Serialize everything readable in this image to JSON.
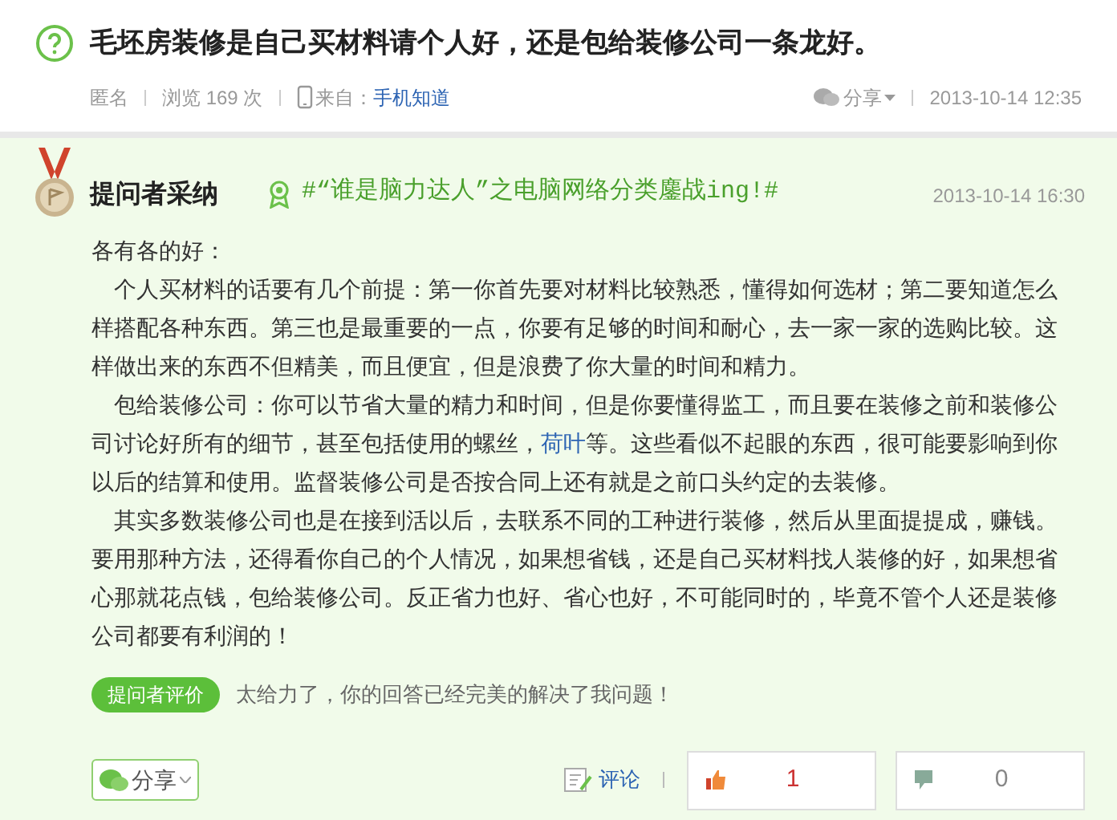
{
  "question": {
    "title": "毛坯房装修是自己买材料请个人好，还是包给装修公司一条龙好。",
    "author": "匿名",
    "views": "浏览 169 次",
    "source_label": "来自：",
    "source": "手机知道",
    "share": "分享",
    "time": "2013-10-14 12:35"
  },
  "answer": {
    "badge": "提问者采纳",
    "topic": "#“谁是脑力达人”之电脑网络分类鏖战ing!#",
    "time": "2013-10-14 16:30",
    "paragraphs": [
      [
        {
          "text": "各有各的好："
        }
      ],
      [
        {
          "text": "个人买材料的话要有几个前提：第一你首先要对材料比较熟悉，懂得如何选材；第二要知道怎么样搭配各种东西。第三也是最重要的一点，你要有足够的时间和耐心，去一家一家的选购比较。这样做出来的东西不但精美，而且便宜，但是浪费了你大量的时间和精力。"
        }
      ],
      [
        {
          "text": "包给装修公司：你可以节省大量的精力和时间，但是你要懂得监工，而且要在装修之前和装修公司讨论好所有的细节，甚至包括使用的螺丝，"
        },
        {
          "text": "荷叶",
          "kind": "link"
        },
        {
          "text": "等。这些看似不起眼的东西，很可能要影响到你以后的结算和使用。监督装修公司是否按合同上还有就是之前口头约定的去装修。"
        }
      ],
      [
        {
          "text": "其实多数装修公司也是在接到活以后，去联系不同的工种进行装修，然后从里面提提成，赚钱。要用那种方法，还得看你自己的个人情况，如果想省钱，还是自己买材料找人装修的好，如果想省心那就花点钱，包给装修公司。反正省力也好、省心也好，不可能同时的，毕竟不管个人还是装修公司都要有利润的！"
        }
      ]
    ],
    "review_label": "提问者评价",
    "review": "太给力了，你的回答已经完美的解决了我问题！",
    "share": "分享",
    "comment": "评论",
    "likes": "1",
    "dislikes": "0"
  }
}
